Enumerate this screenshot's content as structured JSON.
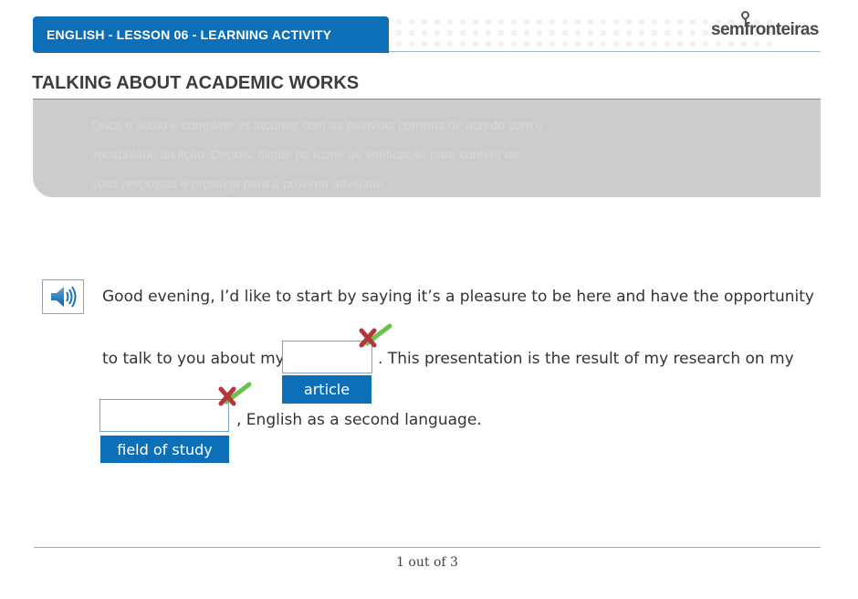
{
  "header": {
    "lesson_title": "ENGLISH - LESSON 06 - LEARNING ACTIVITY",
    "brand_color": "#0d6fb8",
    "logo_text": "semfronteiras"
  },
  "page": {
    "title": "TALKING ABOUT ACADEMIC WORKS",
    "instructions": [
      "Ouça o áudio e complete as lacunas com as palavras corretas de acordo com o",
      "vocabulário da lição. Depois, clique no ícone de verificação para conferir as",
      "suas respostas e prossiga para a próxima atividade."
    ]
  },
  "activity": {
    "audio_icon": "speaker-icon",
    "line1": "Good evening, I’d like to start by saying it’s a pleasure to be here and have the opportunity",
    "line2_before": "to talk to you about my",
    "line2_after": ". This presentation is the result of my research on my",
    "line3_after": ", English as a second language.",
    "blanks": [
      {
        "value": "",
        "placeholder": "",
        "answer_chip": "article"
      },
      {
        "value": "",
        "placeholder": "",
        "answer_chip": "field of study"
      }
    ],
    "wrong_mark_color": "#b5363d",
    "check_mark_color": "#6cc24a"
  },
  "footer": {
    "pager": "1 out of 3"
  }
}
